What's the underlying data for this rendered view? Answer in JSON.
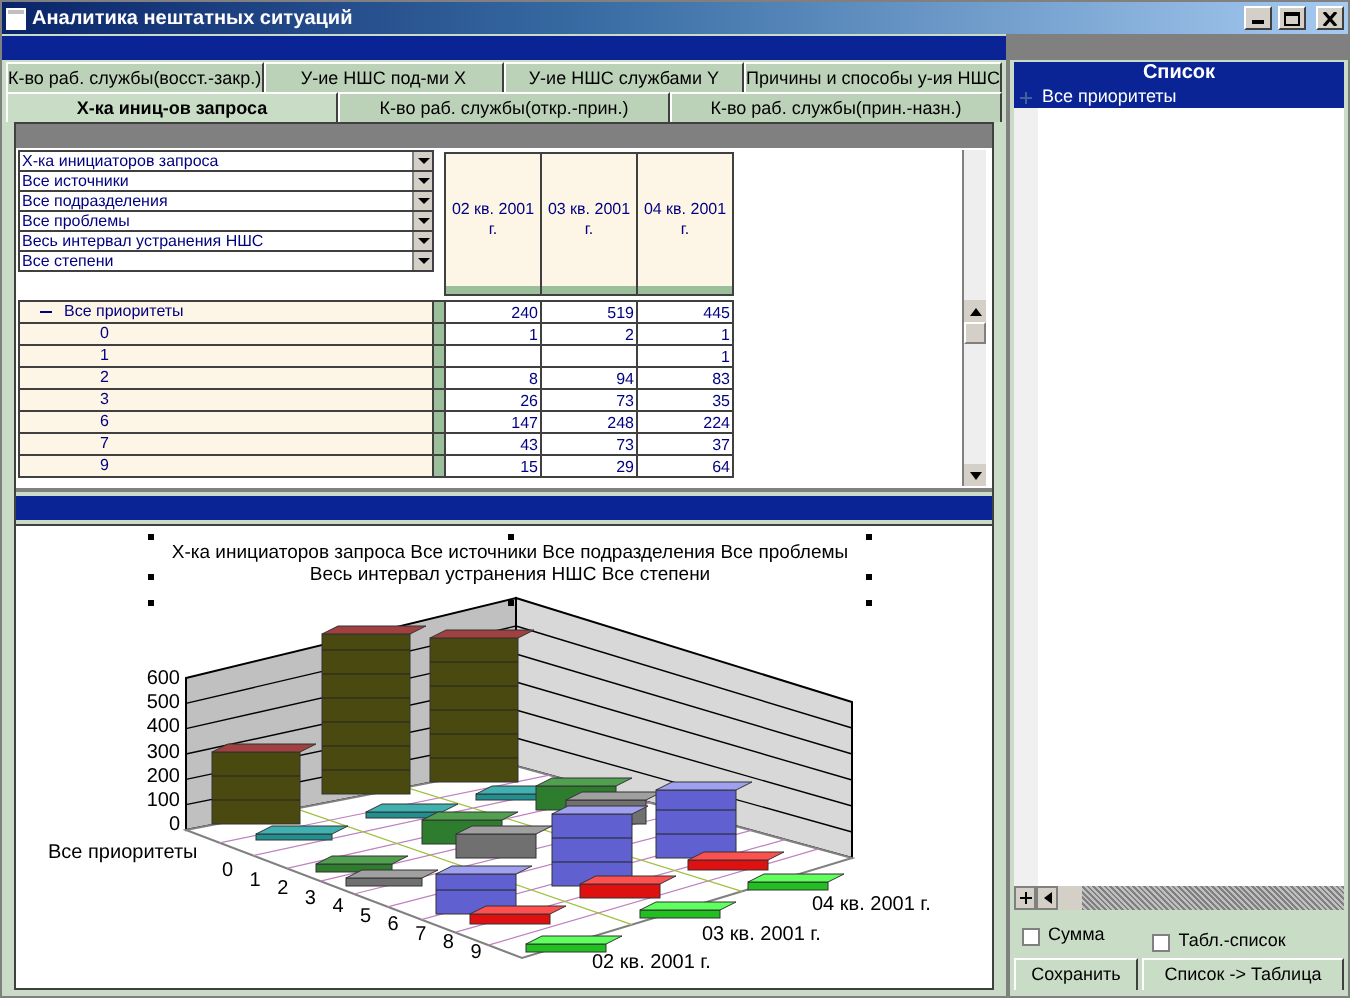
{
  "window": {
    "title": "Аналитика нештатных ситуаций"
  },
  "tab_rows": [
    [
      {
        "label": "К-во раб. службы(восст.-закр.)",
        "selected": false
      },
      {
        "label": "У-ие НШС под-ми X",
        "selected": false
      },
      {
        "label": "У-ие НШС службами Y",
        "selected": false
      },
      {
        "label": "Причины и способы у-ия НШС",
        "selected": false
      }
    ],
    [
      {
        "label": "Х-ка иниц-ов запроса",
        "selected": true
      },
      {
        "label": "К-во раб. службы(откр.-прин.)",
        "selected": false
      },
      {
        "label": "К-во раб. службы(прин.-назн.)",
        "selected": false
      }
    ]
  ],
  "pivot": {
    "filters": [
      "Х-ка инициаторов запроса",
      "Все источники",
      "Все подразделения",
      "Все проблемы",
      "Весь интервал устранения НШС",
      "Все степени"
    ],
    "columns": [
      "02 кв. 2001 г.",
      "03 кв. 2001 г.",
      "04 кв. 2001 г."
    ],
    "rows": [
      {
        "label": "Все приоритеты",
        "expanded": true,
        "values": {
          "col_1": "240",
          "col_2": "519",
          "col_3": "445"
        },
        "children": [
          {
            "label": "0",
            "values": {
              "col_1": "1",
              "col_2": "2",
              "col_3": "1"
            }
          },
          {
            "label": "1",
            "values": {
              "col_3": "1"
            }
          },
          {
            "label": "2",
            "values": {
              "col_1": "8",
              "col_2": "94",
              "col_3": "83"
            }
          },
          {
            "label": "3",
            "values": {
              "col_1": "26",
              "col_2": "73",
              "col_3": "35"
            }
          },
          {
            "label": "6",
            "values": {
              "col_1": "147",
              "col_2": "248",
              "col_3": "224"
            }
          },
          {
            "label": "7",
            "values": {
              "col_1": "43",
              "col_2": "73",
              "col_3": "37"
            }
          },
          {
            "label": "9",
            "values": {
              "col_1": "15",
              "col_2": "29",
              "col_3": "64"
            }
          }
        ]
      }
    ]
  },
  "chart": {
    "title_lines": [
      "Х-ка инициаторов запроса Все источники Все подразделения Все проблемы",
      "Весь интервал устранения НШС Все степени"
    ],
    "y_labels": [
      "600",
      "500",
      "400",
      "300",
      "200",
      "100",
      "0"
    ],
    "row_label": "Все приоритеты",
    "categories": [
      "0",
      "1",
      "2",
      "3",
      "4",
      "5",
      "6",
      "7",
      "8",
      "9"
    ],
    "series_labels": [
      "04 кв. 2001 г.",
      "03 кв. 2001 г.",
      "02 кв. 2001 г."
    ]
  },
  "side_panel": {
    "header": "Список",
    "items": [
      {
        "label": "Все приоритеты",
        "expanded": false,
        "selected": true
      }
    ],
    "checkboxes": [
      {
        "label": "Сумма",
        "checked": false
      },
      {
        "label": "Табл.-список",
        "checked": false
      }
    ],
    "buttons": [
      "Сохранить",
      "Список -> Таблица"
    ]
  }
}
